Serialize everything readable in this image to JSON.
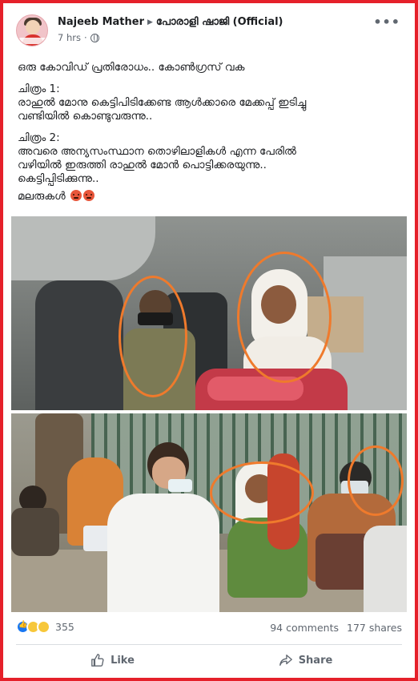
{
  "post": {
    "author": "Najeeb Mather",
    "group": "പോരാളി ഷാജി (Official)",
    "time": "7 hrs",
    "more_label": "•••",
    "text": {
      "line1": "ഒരു കോവിഡ് പ്രതിരോധം.. കോൺഗ്രസ് വക",
      "pic1_heading": "ചിത്രം 1:",
      "pic1_line1": "രാഹുൽ മോനു കെട്ടിപിടിക്കേണ്ട ആൾക്കാരെ മേക്കപ്പ് ഇടിച്ചു",
      "pic1_line2": "വണ്ടിയിൽ കൊണ്ടുവരുന്നു..",
      "pic2_heading": "ചിത്രം 2:",
      "pic2_line1": "അവരെ അന്യസംസ്ഥാന തൊഴിലാളികൾ എന്ന പേരിൽ",
      "pic2_line2": "വഴിയിൽ ഇരുത്തി രാഹുൽ മോൻ പൊട്ടിക്കരയുന്നു..",
      "pic2_line3": "കെട്ടിപ്പിടിക്കുന്നു..",
      "closing": "മലരുകൾ"
    }
  },
  "engagement": {
    "reaction_count": "355",
    "comments": "94 comments",
    "shares": "177 shares"
  },
  "actions": {
    "like": "Like",
    "share": "Share"
  },
  "colors": {
    "frame_border": "#e5202a",
    "highlight_circle": "#ef7a2c",
    "fb_blue": "#1877f2",
    "muted_text": "#606770"
  },
  "icons": [
    "globe-icon",
    "more-options-icon",
    "angry-emoji-icon",
    "like-reaction-icon",
    "haha-reaction-icon",
    "wow-reaction-icon",
    "thumbs-up-icon",
    "share-arrow-icon"
  ]
}
